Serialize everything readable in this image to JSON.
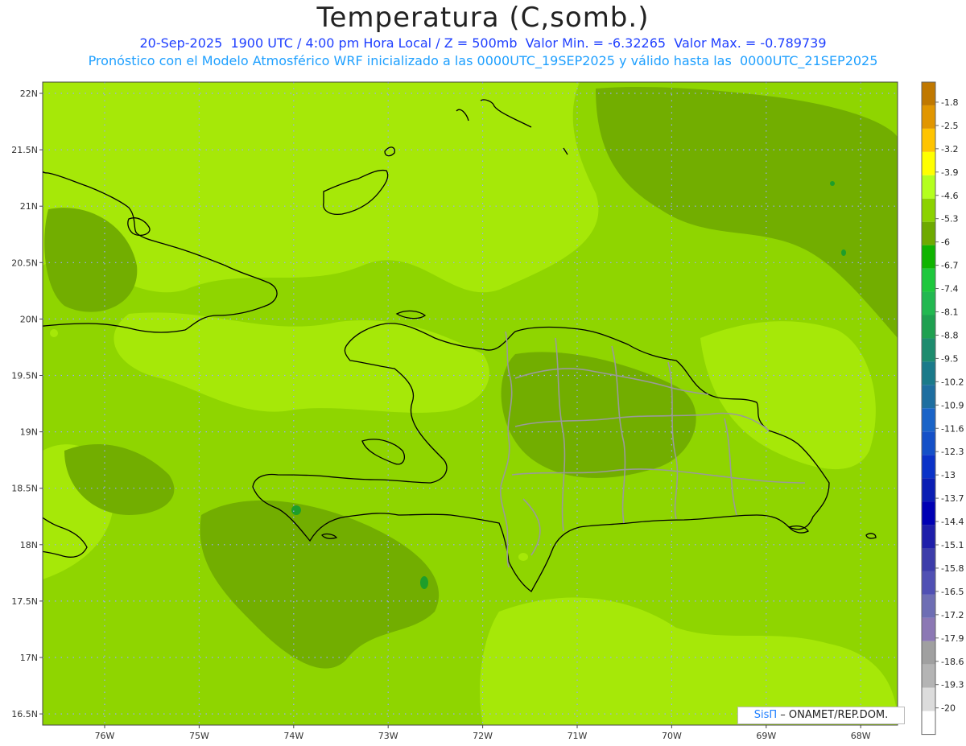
{
  "header": {
    "title": "Temperatura (C,somb.)",
    "line1": "20-Sep-2025  1900 UTC / 4:00 pm Hora Local / Z = 500mb  Valor Min. = -6.32265  Valor Max. = -0.789739",
    "line2": "Pronóstico con el Modelo Atmosférico WRF inicializado a las 0000UTC_19SEP2025 y válido hasta las  0000UTC_21SEP2025"
  },
  "axes": {
    "lat_labels": [
      "22N",
      "21.5N",
      "21N",
      "20.5N",
      "20N",
      "19.5N",
      "19N",
      "18.5N",
      "18N",
      "17.5N",
      "17N",
      "16.5N"
    ],
    "lon_labels": [
      "76W",
      "75W",
      "74W",
      "73W",
      "72W",
      "71W",
      "70W",
      "69W",
      "68W"
    ]
  },
  "colorbar": {
    "labels": [
      "-1.8",
      "-2.5",
      "-3.2",
      "-3.9",
      "-4.6",
      "-5.3",
      "-6",
      "-6.7",
      "-7.4",
      "-8.1",
      "-8.8",
      "-9.5",
      "-10.2",
      "-10.9",
      "-11.6",
      "-12.3",
      "-13",
      "-13.7",
      "-14.4",
      "-15.1",
      "-15.8",
      "-16.5",
      "-17.2",
      "-17.9",
      "-18.6",
      "-19.3",
      "-20"
    ],
    "colors": [
      "#c07800",
      "#e19600",
      "#ffc400",
      "#ffff00",
      "#b4ff1e",
      "#8cd200",
      "#6eaa00",
      "#0fb400",
      "#1ec83c",
      "#22b850",
      "#1fa050",
      "#1e8c6e",
      "#1a7a8a",
      "#1e6ea0",
      "#1a64c8",
      "#1450c8",
      "#0a32c8",
      "#0a1eb4",
      "#0000b4",
      "#1e1eaa",
      "#3c3caa",
      "#5050b4",
      "#6e6eb4",
      "#8c78b4",
      "#a0a0a0",
      "#b4b4b4",
      "#dcdcdc"
    ]
  },
  "map": {
    "base_color": "#8fd500",
    "warm_color": "#a6e808",
    "cool_color": "#72ae00",
    "coast_color": "#000000",
    "province_color": "#9a9a9a",
    "grid_color": "#9aa8ff"
  },
  "credit": {
    "brand": "SisΠ",
    "text": " – ONAMET/REP.DOM."
  }
}
